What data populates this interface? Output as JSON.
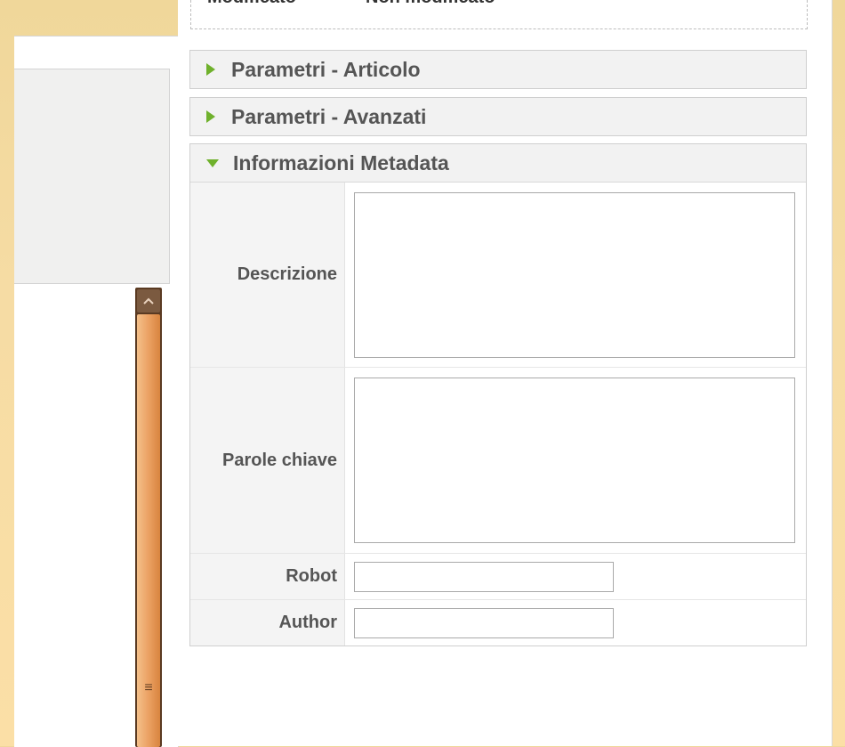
{
  "previous_section": {
    "label": "Modificato",
    "value": "Non modificato"
  },
  "panels": {
    "articolo": {
      "title": "Parametri - Articolo",
      "expanded": false
    },
    "avanzati": {
      "title": "Parametri - Avanzati",
      "expanded": false
    },
    "metadata": {
      "title": "Informazioni Metadata",
      "expanded": true
    }
  },
  "metadata_fields": {
    "descrizione": {
      "label": "Descrizione",
      "value": ""
    },
    "parole_chiave": {
      "label": "Parole chiave",
      "value": ""
    },
    "robot": {
      "label": "Robot",
      "value": ""
    },
    "author": {
      "label": "Author",
      "value": ""
    }
  },
  "scrollbar": {
    "grip": "≡"
  },
  "colors": {
    "toggle_arrow": "#6fb12c",
    "scrollbar_thumb": "#eba163",
    "background": "#f6dca4"
  }
}
